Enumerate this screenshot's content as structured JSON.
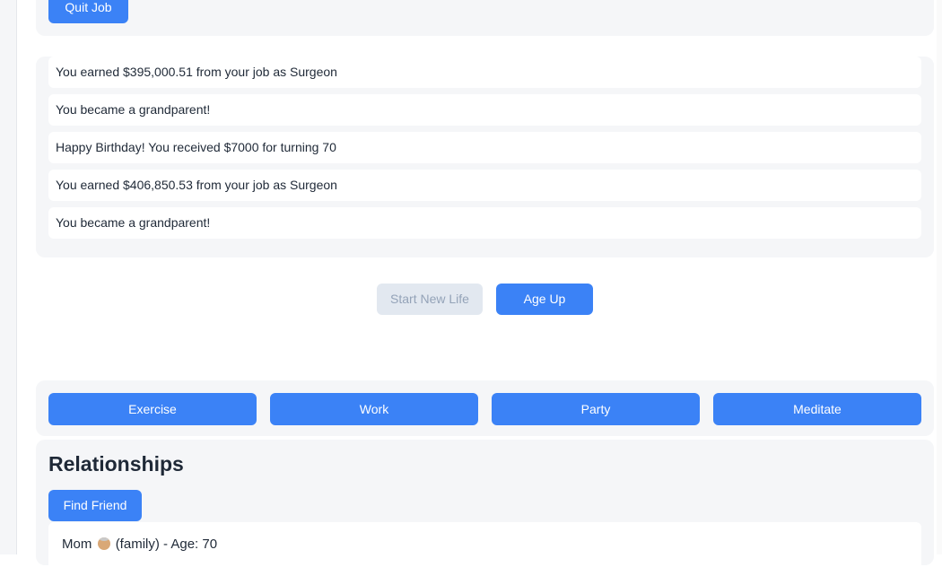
{
  "job": {
    "quit_label": "Quit Job"
  },
  "log": [
    "You earned $395,000.51 from your job as Surgeon",
    "You became a grandparent!",
    "Happy Birthday! You received $7000 for turning 70",
    "You earned $406,850.53 from your job as Surgeon",
    "You became a grandparent!"
  ],
  "controls": {
    "start_new_life": "Start New Life",
    "age_up": "Age Up"
  },
  "activities": [
    "Exercise",
    "Work",
    "Party",
    "Meditate"
  ],
  "relationships": {
    "title": "Relationships",
    "find_friend": "Find Friend",
    "items": [
      {
        "name": "Mom",
        "emoji": "older-woman-emoji",
        "relation": "(family) - Age: 70"
      }
    ]
  },
  "colors": {
    "primary": "#3b82f6",
    "disabled": "#e2e8f0",
    "panel": "#f5f6f8"
  }
}
